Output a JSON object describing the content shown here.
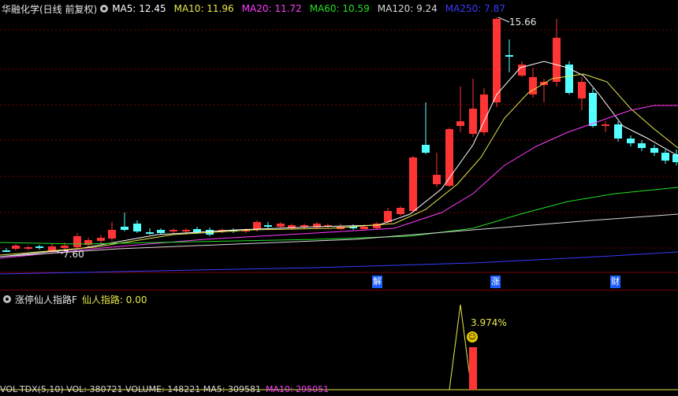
{
  "header": {
    "title": "华融化学(日线 前复权)",
    "ma": [
      {
        "label": "MA5: 12.45",
        "color": "#ffffff"
      },
      {
        "label": "MA10: 11.96",
        "color": "#e8e84a"
      },
      {
        "label": "MA20: 11.72",
        "color": "#ff3cff"
      },
      {
        "label": "MA60: 10.59",
        "color": "#22e022"
      },
      {
        "label": "MA120: 9.24",
        "color": "#d8d8d8"
      },
      {
        "label": "MA250: 7.87",
        "color": "#3a3aff"
      }
    ]
  },
  "main": {
    "high_label": "15.66",
    "low_label": "7.60",
    "markers": [
      "解",
      "涨",
      "财"
    ]
  },
  "sub": {
    "title": "涨停仙人指路F",
    "value_label": "仙人指路: 0.00",
    "peak_label": "3.974%"
  },
  "bottom": {
    "items": [
      {
        "text": "VOL-TDX(5,10)  VOL: 380721  VOLUME: 148221  MA5: 309581",
        "color": "#d8d8d8"
      },
      {
        "text": "MA10: 295051",
        "color": "#ff3cff"
      }
    ]
  },
  "colors": {
    "up": "#ff3434",
    "down": "#54ffff",
    "grid": "#7a0000",
    "accent": "#e8e84a"
  }
}
